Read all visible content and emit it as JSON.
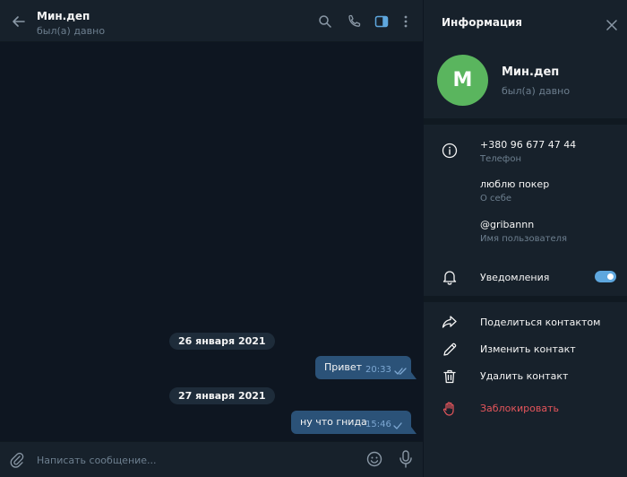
{
  "chat": {
    "title": "Мин.деп",
    "status": "был(а) давно",
    "compose_placeholder": "Написать сообщение...",
    "days": [
      {
        "date": "26 января 2021",
        "messages": [
          {
            "text": "Привет",
            "time": "20:33",
            "read": true
          }
        ]
      },
      {
        "date": "27 января 2021",
        "messages": [
          {
            "text": "ну что гнида",
            "time": "15:46",
            "read": false
          }
        ]
      }
    ]
  },
  "info": {
    "title": "Информация",
    "avatar_letter": "M",
    "avatar_color": "#5ab55e",
    "name": "Мин.деп",
    "status": "был(а) давно",
    "phone": {
      "value": "+380 96 677 47 44",
      "label": "Телефон"
    },
    "about": {
      "value": "люблю покер",
      "label": "О себе"
    },
    "username": {
      "value": "@gribannn",
      "label": "Имя пользователя"
    },
    "notifications": {
      "label": "Уведомления",
      "enabled": true
    },
    "actions": [
      {
        "label": "Поделиться контактом",
        "icon": "share-icon",
        "danger": false
      },
      {
        "label": "Изменить контакт",
        "icon": "pencil-icon",
        "danger": false
      },
      {
        "label": "Удалить контакт",
        "icon": "trash-icon",
        "danger": false
      },
      {
        "label": "Заблокировать",
        "icon": "block-hand-icon",
        "danger": true
      }
    ]
  },
  "colors": {
    "accent": "#5ea7de",
    "bubble_out": "#2b5278",
    "danger": "#e4555b",
    "panel": "#17212b",
    "chat_bg": "#0e1621"
  }
}
